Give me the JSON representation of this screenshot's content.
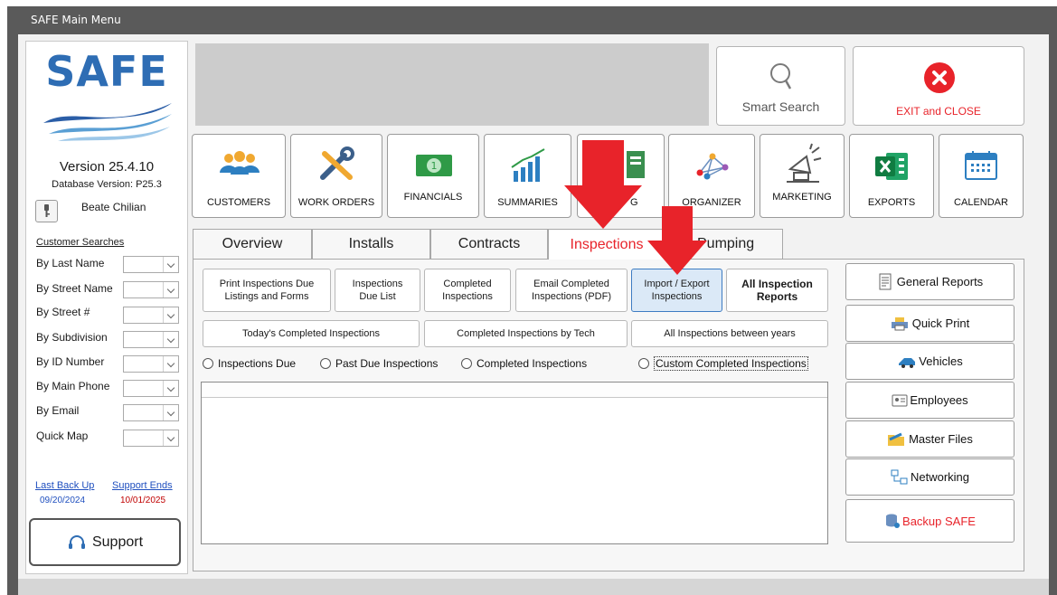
{
  "window": {
    "title": "SAFE Main Menu"
  },
  "sidebar": {
    "logo_text": "SAFE",
    "version": "Version 25.4.10",
    "db_version": "Database Version: P25.3",
    "user_name": "Beate Chilian",
    "searches_heading": "Customer Searches",
    "searches": [
      {
        "label": "By Last Name"
      },
      {
        "label": "By Street Name"
      },
      {
        "label": "By Street #"
      },
      {
        "label": "By Subdivision"
      },
      {
        "label": "By ID Number"
      },
      {
        "label": "By Main Phone"
      },
      {
        "label": "By Email"
      },
      {
        "label": "Quick Map"
      }
    ],
    "last_backup_label": "Last Back Up",
    "last_backup_date": "09/20/2024",
    "support_ends_label": "Support Ends",
    "support_ends_date": "10/01/2025",
    "support_button": "Support"
  },
  "header": {
    "smart_search": "Smart Search",
    "exit_close": "EXIT and CLOSE"
  },
  "modules": [
    {
      "label": "CUSTOMERS",
      "icon": "customers-icon"
    },
    {
      "label": "WORK ORDERS",
      "icon": "tools-icon"
    },
    {
      "label": "FINANCIALS",
      "icon": "money-icon"
    },
    {
      "label": "SUMMARIES",
      "icon": "bar-chart-icon"
    },
    {
      "label": "G",
      "icon": "clipboard-icon"
    },
    {
      "label": "ORGANIZER",
      "icon": "network-icon"
    },
    {
      "label": "MARKETING",
      "icon": "megaphone-icon"
    },
    {
      "label": "EXPORTS",
      "icon": "excel-icon"
    },
    {
      "label": "CALENDAR",
      "icon": "calendar-icon"
    }
  ],
  "tabs": [
    {
      "label": "Overview"
    },
    {
      "label": "Installs"
    },
    {
      "label": "Contracts"
    },
    {
      "label": "Inspections",
      "active": true
    },
    {
      "label": "Pumping"
    }
  ],
  "inspections": {
    "buttons_row1": [
      {
        "label": "Print Inspections Due Listings and Forms"
      },
      {
        "label": "Inspections Due List"
      },
      {
        "label": "Completed Inspections"
      },
      {
        "label": "Email Completed Inspections (PDF)"
      },
      {
        "label": "Import / Export Inspections"
      },
      {
        "label": "All Inspection Reports"
      }
    ],
    "buttons_row2": [
      {
        "label": "Today's Completed Inspections"
      },
      {
        "label": "Completed Inspections by Tech"
      },
      {
        "label": "All Inspections between years"
      }
    ],
    "radios": [
      {
        "label": "Inspections Due"
      },
      {
        "label": "Past Due Inspections"
      },
      {
        "label": "Completed Inspections"
      },
      {
        "label": "Custom Completed Inspections"
      }
    ]
  },
  "side_buttons": [
    {
      "label": "General Reports",
      "icon": "document-icon"
    },
    {
      "label": "Quick Print",
      "icon": "printer-icon"
    },
    {
      "label": "Vehicles",
      "icon": "truck-icon"
    },
    {
      "label": "Employees",
      "icon": "id-card-icon"
    },
    {
      "label": "Master Files",
      "icon": "folder-icon"
    },
    {
      "label": "Networking",
      "icon": "network-computers-icon"
    },
    {
      "label": "Backup SAFE",
      "icon": "database-icon"
    }
  ],
  "colors": {
    "accent_red": "#e8232a",
    "tab_active_text": "#e8232a",
    "link_blue": "#1f4fbf",
    "logo_blue": "#2e6db4",
    "highlight_button": "#dbe9f7"
  }
}
